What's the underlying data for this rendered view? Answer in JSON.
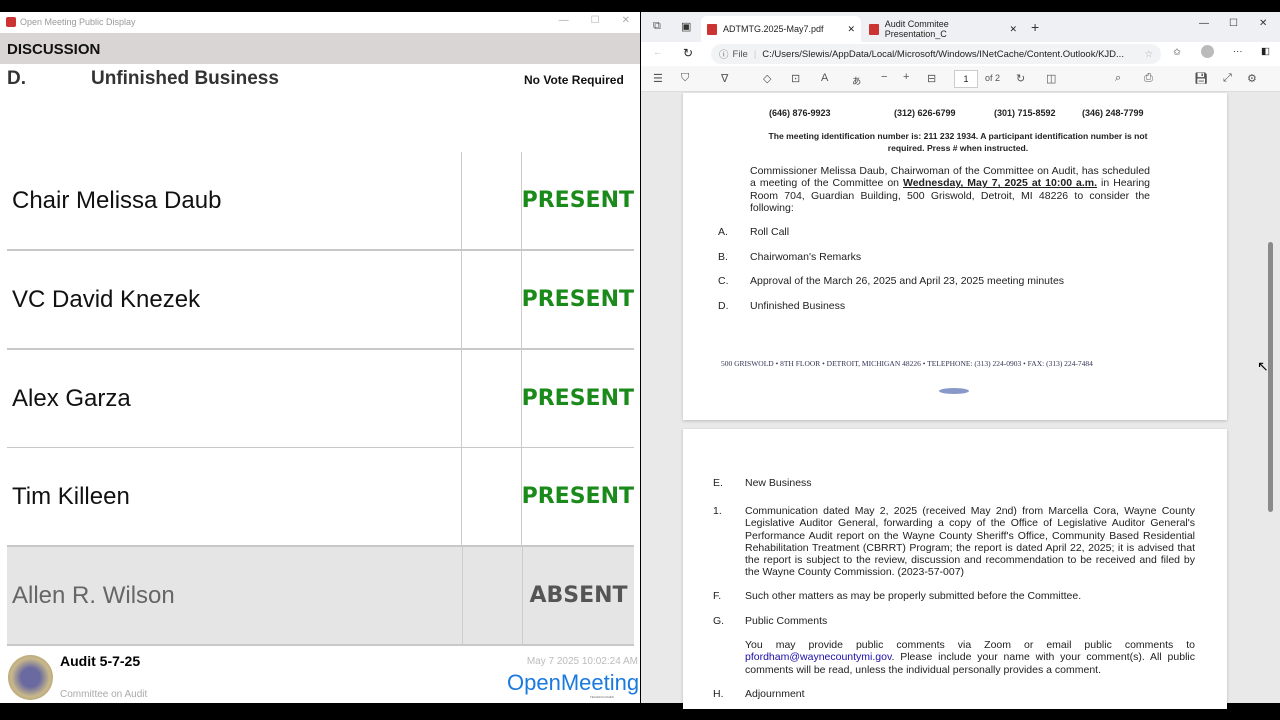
{
  "left": {
    "window_title": "Open Meeting Public Display",
    "section": "DISCUSSION",
    "item_letter": "D.",
    "item_title": "Unfinished Business",
    "vote_note": "No Vote Required",
    "members": [
      {
        "name": "Chair Melissa Daub",
        "status": "PRESENT"
      },
      {
        "name": "VC David Knezek",
        "status": "PRESENT"
      },
      {
        "name": "Alex  Garza",
        "status": "PRESENT"
      },
      {
        "name": "Tim Killeen",
        "status": "PRESENT"
      },
      {
        "name": "Allen R. Wilson",
        "status": "ABSENT"
      }
    ],
    "footer": {
      "meeting": "Audit 5-7-25",
      "committee": "Committee on Audit",
      "timestamp": "May 7 2025 10:02:24 AM",
      "logo": "OpenMeeting",
      "logo_sub": "TECHNOLOGIES"
    },
    "colors": {
      "present": "#1a8a1a",
      "absent": "#555555"
    }
  },
  "browser": {
    "tabs": [
      {
        "label": "ADTMTG.2025-May7.pdf"
      },
      {
        "label": "Audit Commitee Presentation_C"
      }
    ],
    "address_prefix": "File",
    "url": "C:/Users/Slewis/AppData/Local/Microsoft/Windows/INetCache/Content.Outlook/KJD...",
    "page_num": "1",
    "page_total": "of 2"
  },
  "doc": {
    "phones": [
      "(646) 876-9923",
      "(312) 626-6799",
      "(301) 715-8592",
      "(346) 248-7799"
    ],
    "meeting_id": "The meeting identification number is: 211 232 1934.  A participant identification number is not required. Press # when instructed.",
    "intro_a": "Commissioner Melissa Daub, Chairwoman of the Committee on Audit, has scheduled a meeting of the Committee on ",
    "intro_date": "Wednesday, May 7, 2025 at 10:00 a.m.",
    "intro_b": " in Hearing Room 704, Guardian Building, 500 Griswold, Detroit, MI 48226 to consider the following:",
    "items1": [
      {
        "l": "A.",
        "t": "Roll Call"
      },
      {
        "l": "B.",
        "t": "Chairwoman's Remarks"
      },
      {
        "l": "C.",
        "t": "Approval of the March 26, 2025 and April 23, 2025 meeting minutes"
      },
      {
        "l": "D.",
        "t": "Unfinished Business"
      }
    ],
    "address_footer": "500 GRISWOLD • 8TH FLOOR • DETROIT, MICHIGAN 48226 • TELEPHONE: (313) 224-0903 • FAX: (313) 224-7484",
    "e_label": "E.",
    "e_text": "New Business",
    "one_label": "1.",
    "one_text": "Communication dated May 2, 2025 (received May 2nd) from Marcella Cora, Wayne County Legislative Auditor General, forwarding a copy of the Office of Legislative Auditor General's Performance Audit report on the Wayne County Sheriff's Office, Community Based Residential Rehabilitation Treatment (CBRRT) Program; the report is dated April 22, 2025; it is advised that the report is subject to the review, discussion and recommendation to be received and filed by the Wayne County Commission. (2023-57-007)",
    "f_label": "F.",
    "f_text": "Such other matters as may be properly submitted before the Committee.",
    "g_label": "G.",
    "g_text": "Public Comments",
    "g_body_a": "You may provide public comments via Zoom or email public comments to ",
    "g_email": "pfordham@waynecountymi.gov",
    "g_body_b": ". Please include your name with your comment(s). All public comments will be read, unless the individual personally provides a comment.",
    "h_label": "H.",
    "h_text": "Adjournment"
  }
}
